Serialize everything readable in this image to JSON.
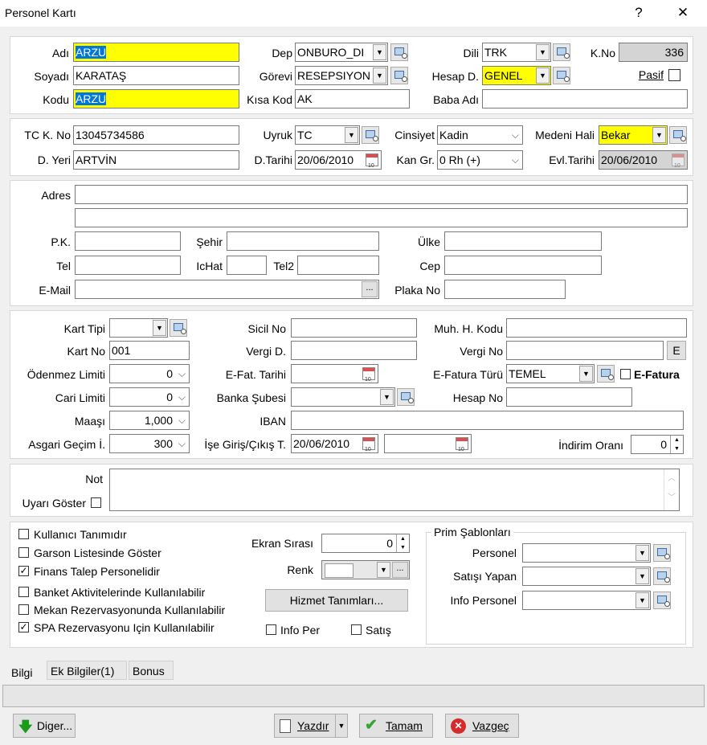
{
  "window": {
    "title": "Personel Kartı",
    "help": "?",
    "close": "✕"
  },
  "identity": {
    "adi_label": "Adı",
    "adi_value": "ARZU",
    "soyadi_label": "Soyadı",
    "soyadi_value": "KARATAŞ",
    "kodu_label": "Kodu",
    "kodu_value": "ARZU",
    "dep_label": "Dep",
    "dep_value": "ONBURO_DI",
    "gorevi_label": "Görevi",
    "gorevi_value": "RESEPSIYON",
    "kisakod_label": "Kısa Kod",
    "kisakod_value": "AK",
    "dili_label": "Dili",
    "dili_value": "TRK",
    "hesapd_label": "Hesap D.",
    "hesapd_value": "GENEL",
    "babaadi_label": "Baba Adı",
    "babaadi_value": "",
    "kno_label": "K.No",
    "kno_value": "336",
    "pasif_label": "Pasif"
  },
  "personal": {
    "tc_label": "TC K. No",
    "tc_value": "13045734586",
    "dyeri_label": "D. Yeri",
    "dyeri_value": "ARTVİN",
    "uyruk_label": "Uyruk",
    "uyruk_value": "TC",
    "dtarihi_label": "D.Tarihi",
    "dtarihi_value": "20/06/2010",
    "cinsiyet_label": "Cinsiyet",
    "cinsiyet_value": "Kadin",
    "kangr_label": "Kan Gr.",
    "kangr_value": "0 Rh (+)",
    "medeni_label": "Medeni Hali",
    "medeni_value": "Bekar",
    "evltarihi_label": "Evl.Tarihi",
    "evltarihi_value": "20/06/2010"
  },
  "address": {
    "adres_label": "Adres",
    "adres1": "",
    "adres2": "",
    "pk_label": "P.K.",
    "pk_value": "",
    "sehir_label": "Şehir",
    "sehir_value": "",
    "ulke_label": "Ülke",
    "ulke_value": "",
    "tel_label": "Tel",
    "tel_value": "",
    "ichat_label": "IcHat",
    "ichat_value": "",
    "tel2_label": "Tel2",
    "tel2_value": "",
    "cep_label": "Cep",
    "cep_value": "",
    "email_label": "E-Mail",
    "email_value": "",
    "email_btn": "...",
    "plaka_label": "Plaka No",
    "plaka_value": ""
  },
  "finance": {
    "karttipi_label": "Kart Tipi",
    "karttipi_value": "",
    "kartno_label": "Kart No",
    "kartno_value": "001",
    "odenmez_label": "Ödenmez Limiti",
    "odenmez_value": "0",
    "cari_label": "Cari Limiti",
    "cari_value": "0",
    "maasi_label": "Maaşı",
    "maasi_value": "1,000",
    "asgari_label": "Asgari Geçim İ.",
    "asgari_value": "300",
    "sicil_label": "Sicil No",
    "sicil_value": "",
    "vergid_label": "Vergi D.",
    "vergid_value": "",
    "efat_label": "E-Fat. Tarihi",
    "efat_value": "",
    "banka_label": "Banka Şubesi",
    "banka_value": "",
    "iban_label": "IBAN",
    "iban_value": "",
    "isegiris_label": "İşe Giriş/Çıkış T.",
    "isegiris_value": "20/06/2010",
    "cikis_value": "",
    "muhkodu_label": "Muh. H. Kodu",
    "muhkodu_value": "",
    "vergino_label": "Vergi No",
    "vergino_value": "",
    "vergino_btn": "E",
    "efaturaturu_label": "E-Fatura Türü",
    "efaturaturu_value": "TEMEL",
    "efatura_chk_label": "E-Fatura",
    "hesapno_label": "Hesap No",
    "hesapno_value": "",
    "indirim_label": "İndirim Oranı",
    "indirim_value": "0"
  },
  "note": {
    "not_label": "Not",
    "not_value": "",
    "uyari_label": "Uyarı Göster"
  },
  "options": {
    "kullanici": "Kullanıcı Tanımıdır",
    "garson": "Garson Listesinde Göster",
    "finans": "Finans Talep Personelidir",
    "banket": "Banket Aktivitelerinde Kullanılabilir",
    "mekan": "Mekan Rezervasyonunda Kullanılabilir",
    "spa": "SPA Rezervasyonu Için Kullanılabilir",
    "ekran_label": "Ekran Sırası",
    "ekran_value": "0",
    "renk_label": "Renk",
    "renk_btn": "...",
    "hizmet_btn": "Hizmet Tanımları...",
    "infoper": "Info Per",
    "satis": "Satış",
    "prim_title": "Prim Şablonları",
    "prim_personel": "Personel",
    "prim_satisi": "Satışı Yapan",
    "prim_info": "Info Personel"
  },
  "tabs": [
    "Bilgi",
    "Ek Bilgiler(1)",
    "Bonus"
  ],
  "footer": {
    "diger": "Diger...",
    "yazdir": "Yazdır",
    "tamam": "Tamam",
    "vazgec": "Vazgeç"
  }
}
